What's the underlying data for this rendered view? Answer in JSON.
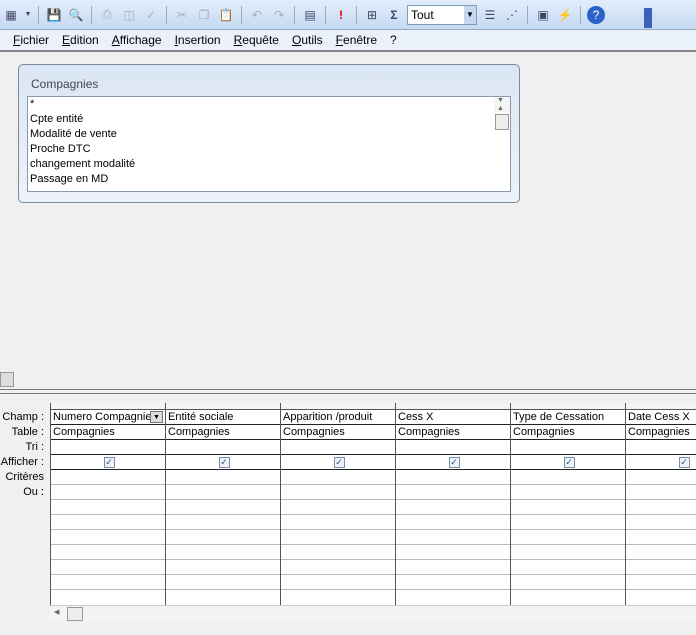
{
  "toolbar": {
    "icons": [
      "view-icon",
      "save-icon",
      "search-file-icon",
      "print-icon",
      "print-preview-icon",
      "spelling-icon",
      "cut-icon",
      "copy-icon",
      "paste-icon",
      "undo-icon",
      "redo-icon",
      "query-type-icon",
      "run-icon",
      "show-table-icon",
      "totals-icon",
      "properties-icon",
      "builder-icon",
      "database-window-icon",
      "new-object-icon",
      "help-icon"
    ],
    "top_values": "Tout"
  },
  "menu": [
    "Fichier",
    "Edition",
    "Affichage",
    "Insertion",
    "Requête",
    "Outils",
    "Fenêtre",
    "?"
  ],
  "table_window": {
    "title": "Compagnies",
    "fields": [
      "*",
      "Cpte entité",
      "Modalité de vente",
      "Proche DTC",
      "changement modalité",
      "Passage en MD"
    ]
  },
  "grid": {
    "row_labels": [
      "Champ :",
      "Table :",
      "Tri :",
      "Afficher :",
      "Critères :",
      "Ou :"
    ],
    "columns": [
      {
        "field": "Numero Compagnie",
        "table": "Compagnies",
        "show": true
      },
      {
        "field": "Entité sociale",
        "table": "Compagnies",
        "show": true
      },
      {
        "field": "Apparition /produit",
        "table": "Compagnies",
        "show": true
      },
      {
        "field": "Cess X",
        "table": "Compagnies",
        "show": true
      },
      {
        "field": "Type de Cessation",
        "table": "Compagnies",
        "show": true
      },
      {
        "field": "Date Cess X",
        "table": "Compagnies",
        "show": true
      }
    ]
  }
}
